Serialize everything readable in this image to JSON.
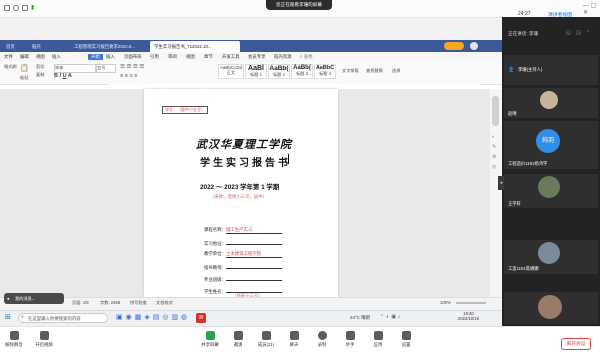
{
  "meeting": {
    "share_notice": "您正在观看李珊的屏幕",
    "time": "24:27",
    "minimize_label": "演讲者视图",
    "speaking": "正在讲话: 李珊"
  },
  "wps": {
    "tabs": [
      "首页",
      "稻壳",
      "工程管理实习报告要求2022.6...",
      "学生实习报告书_712022.10..."
    ],
    "menus": [
      "文件",
      "编辑",
      "视图",
      "插入",
      "开始",
      "插入",
      "页面布局",
      "引用",
      "审阅",
      "视图",
      "章节",
      "开发工具",
      "会员专享",
      "稻壳资源"
    ],
    "active_menu": "开始",
    "search_label": "查找",
    "ribbon_left": [
      "格式刷",
      "粘贴",
      "剪切",
      "复制"
    ],
    "font_name": "宋体",
    "font_size": "五号",
    "styles": [
      {
        "sample": "AaBbCcDd",
        "label": "正文"
      },
      {
        "sample": "AaBl",
        "label": "标题 1"
      },
      {
        "sample": "AaBb(",
        "label": "标题 2"
      },
      {
        "sample": "AaBb(",
        "label": "标题 3"
      },
      {
        "sample": "AaBbC",
        "label": "标题 4"
      }
    ],
    "style_panel_label": "文字排版",
    "find_label": "查找替换",
    "select_label": "选择"
  },
  "document": {
    "stamp": "学号：（居中小五号）",
    "school_name": "武汉华夏理工学院",
    "report_title": "学生实习报告书",
    "year_line": "2022 ～ 2023 学年第 1 学期",
    "font_note": "（宋体，黑体小三号，居中）",
    "fields": [
      {
        "label": "课程名称：",
        "value": "施工生产实习"
      },
      {
        "label": "实习地址：",
        "value": ""
      },
      {
        "label": "教学单位：",
        "value": "土木建筑工程学院"
      },
      {
        "label": "指导教师：",
        "value": ""
      },
      {
        "label": "专业班级：",
        "value": ""
      },
      {
        "label": "学生姓名：",
        "value": ""
      }
    ],
    "bottom_note": "（仿宋小三号）"
  },
  "statusbar": {
    "page": "页面: 1/8",
    "words": "字数: 2468",
    "spell": "拼写检查",
    "text_check": "文档校对",
    "zoom": "100%"
  },
  "taskbar": {
    "search_placeholder": "在这里输入你要搜索的内容",
    "weather": "24°C 晴朗",
    "clock_time": "16:30",
    "clock_date": "2022/10/16"
  },
  "notification": {
    "text": "我的消息..."
  },
  "participants": [
    {
      "name": "李珊(主持人)",
      "avatar_color": "#4a4a4a"
    },
    {
      "name": "赵晴",
      "avatar_color": "#c7b39a"
    },
    {
      "name": "纯羽",
      "avatar_color": "#2f8ee5"
    },
    {
      "name": "工程造价1191杨鸿宇",
      "avatar_color": "#8a8a8a"
    },
    {
      "name": "王宇轩",
      "avatar_color": "#6a7a5a"
    },
    {
      "name": "工造1191陈娜娜",
      "avatar_color": "#7a8a9a"
    },
    {
      "name": "",
      "avatar_color": "#9a7a6a"
    }
  ],
  "bottom_toolbar": {
    "buttons": [
      "解除静音",
      "开启视频",
      "共享屏幕",
      "邀请",
      "成员(21)",
      "聊天",
      "录制",
      "举手",
      "应用",
      "设置"
    ],
    "end_label": "离开会议",
    "end_color": "#e04040"
  }
}
